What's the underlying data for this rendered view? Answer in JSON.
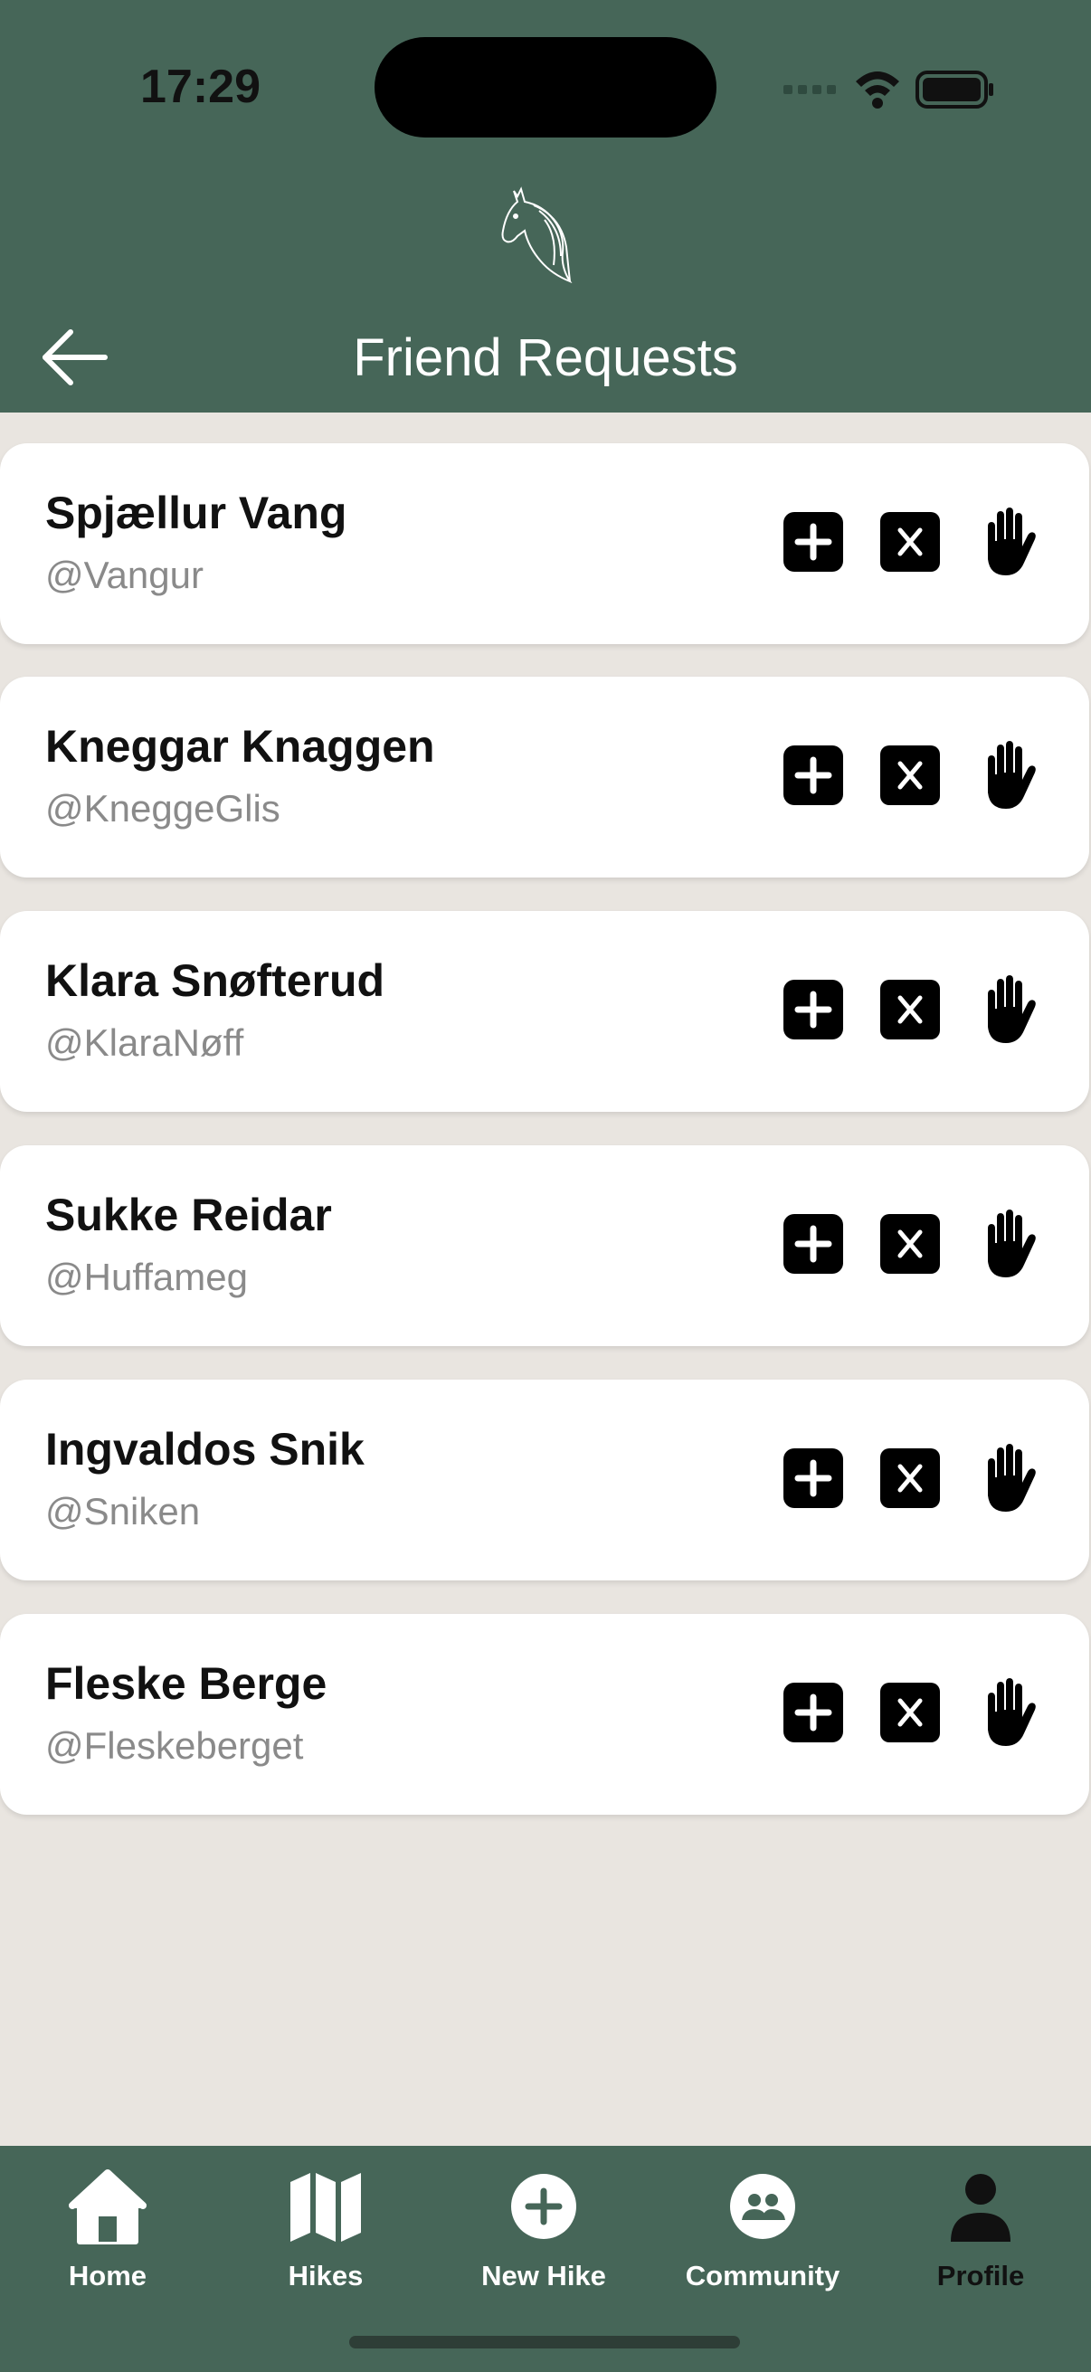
{
  "status_bar": {
    "time": "17:29"
  },
  "header": {
    "title": "Friend Requests"
  },
  "requests": [
    {
      "name": "Spjællur Vang",
      "handle": "@Vangur"
    },
    {
      "name": "Kneggar Knaggen",
      "handle": "@KneggeGlis"
    },
    {
      "name": "Klara Snøfterud",
      "handle": "@KlaraNøff"
    },
    {
      "name": "Sukke Reidar",
      "handle": "@Huffameg"
    },
    {
      "name": "Ingvaldos Snik",
      "handle": "@Sniken"
    },
    {
      "name": "Fleske Berge",
      "handle": "@Fleskeberget"
    }
  ],
  "tabbar": {
    "items": [
      {
        "label": "Home",
        "icon": "home-icon"
      },
      {
        "label": "Hikes",
        "icon": "map-icon"
      },
      {
        "label": "New Hike",
        "icon": "plus-circle-icon"
      },
      {
        "label": "Community",
        "icon": "people-icon"
      },
      {
        "label": "Profile",
        "icon": "person-icon",
        "active": true
      }
    ]
  },
  "colors": {
    "brand_green": "#466658",
    "background": "#e9e5e0",
    "card": "#ffffff",
    "handle_text": "#8a8a8a"
  }
}
